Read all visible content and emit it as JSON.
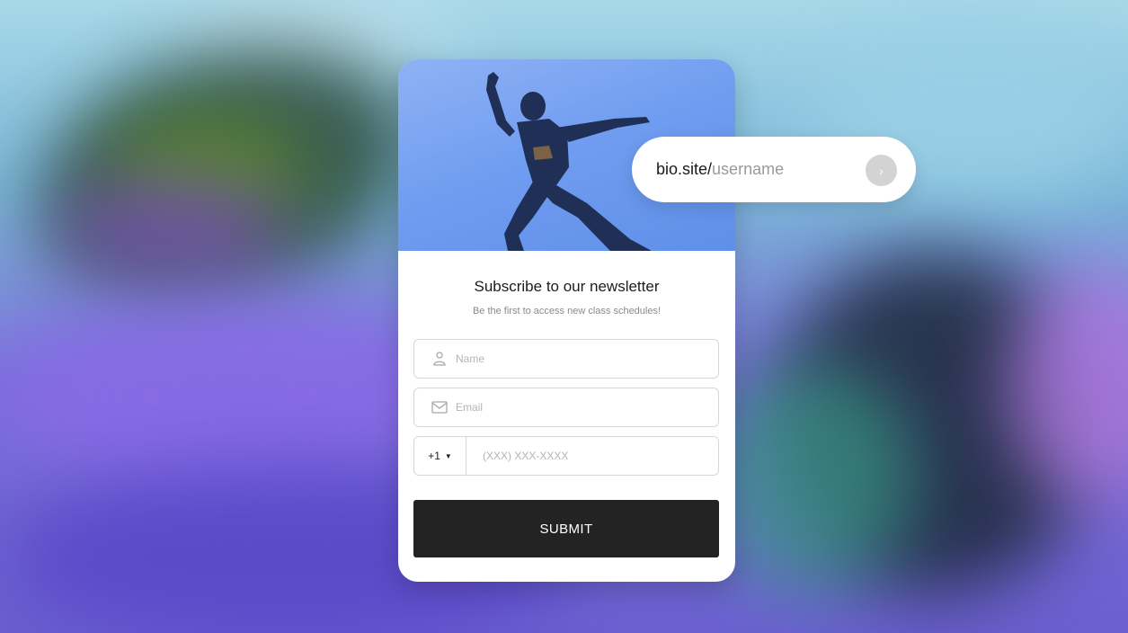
{
  "link_pill": {
    "domain": "bio.site/",
    "username_placeholder": "username",
    "go_icon": "chevron-right-icon"
  },
  "form": {
    "title": "Subscribe to our newsletter",
    "subtitle": "Be the first to access new class schedules!",
    "name_placeholder": "Name",
    "email_placeholder": "Email",
    "country_code": "+1",
    "phone_placeholder": "(XXX) XXX-XXXX",
    "submit_label": "SUBMIT"
  },
  "colors": {
    "submit_bg": "#232323",
    "hero_bg": "#6f9cf0",
    "card_bg": "#ffffff"
  }
}
